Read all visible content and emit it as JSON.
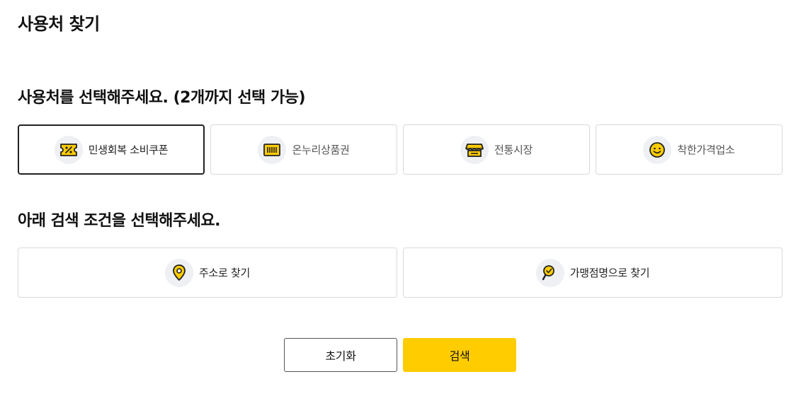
{
  "page": {
    "title": "사용처 찾기"
  },
  "usage_section": {
    "title": "사용처를 선택해주세요. (2개까지 선택 가능)",
    "options": [
      {
        "label": "민생회복 소비쿠폰",
        "icon": "coupon-icon",
        "selected": true
      },
      {
        "label": "온누리상품권",
        "icon": "gift-card-icon",
        "selected": false
      },
      {
        "label": "전통시장",
        "icon": "market-stall-icon",
        "selected": false
      },
      {
        "label": "착한가격업소",
        "icon": "smile-icon",
        "selected": false
      }
    ]
  },
  "search_section": {
    "title": "아래 검색 조건을 선택해주세요.",
    "options": [
      {
        "label": "주소로 찾기",
        "icon": "location-pin-icon"
      },
      {
        "label": "가맹점명으로 찾기",
        "icon": "store-search-icon"
      }
    ]
  },
  "actions": {
    "reset_label": "초기화",
    "search_label": "검색"
  },
  "colors": {
    "accent": "#ffcc00",
    "icon_stroke": "#222222",
    "icon_bg": "#eef0f3",
    "border": "#d9d9d9",
    "selected_border": "#222222"
  }
}
